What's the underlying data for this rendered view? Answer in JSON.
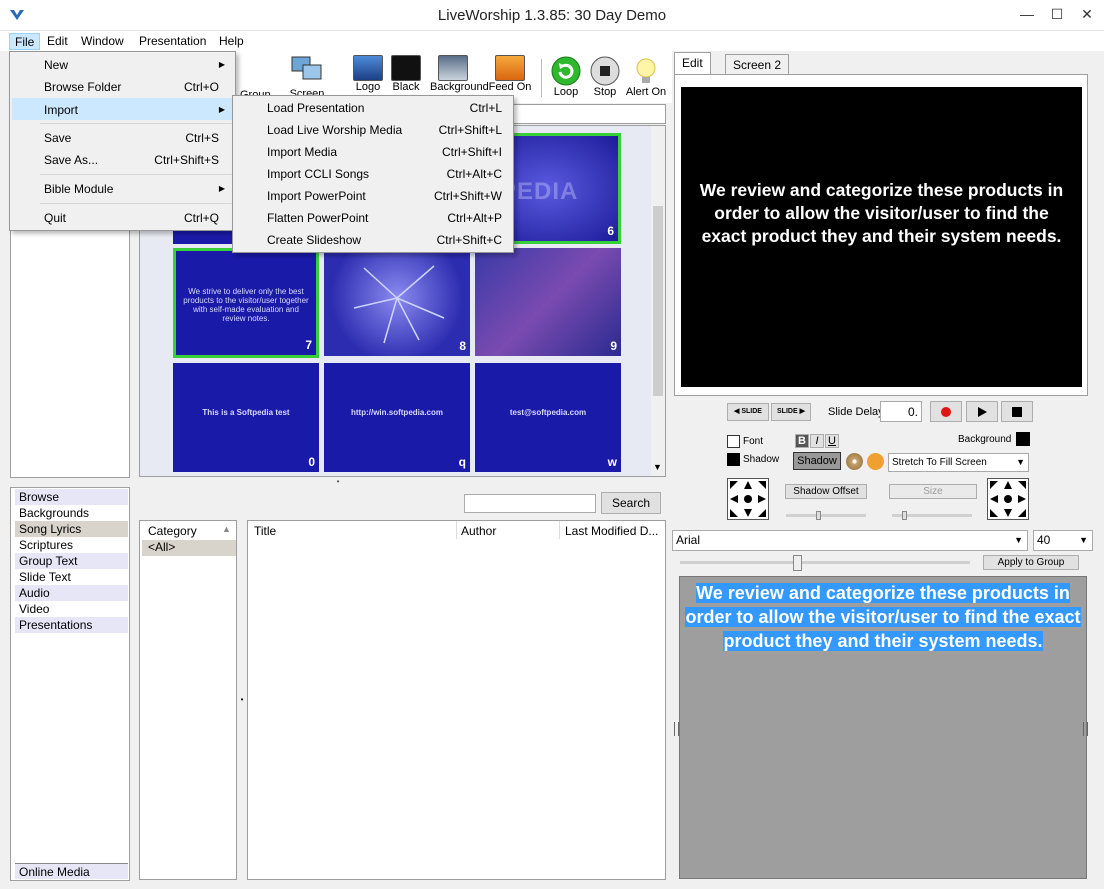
{
  "window": {
    "title": "LiveWorship 1.3.85: 30 Day Demo",
    "minimize": "—",
    "maximize": "☐",
    "close": "✕"
  },
  "menubar": [
    "File",
    "Edit",
    "Window",
    "Presentation",
    "Help"
  ],
  "toolbar": {
    "partial_labels": [
      "Group",
      "Screen 2 On"
    ],
    "buttons": [
      {
        "label": "Logo",
        "icon": "logo-icon"
      },
      {
        "label": "Black",
        "icon": "black-screen-icon"
      },
      {
        "label": "Background",
        "icon": "background-icon"
      },
      {
        "label": "Feed On",
        "icon": "feed-icon"
      },
      {
        "label": "Loop",
        "icon": "loop-icon"
      },
      {
        "label": "Stop",
        "icon": "stop-icon"
      },
      {
        "label": "Alert On",
        "icon": "bulb-icon"
      }
    ]
  },
  "file_menu": [
    {
      "label": "New",
      "shortcut": "",
      "submenu": true
    },
    {
      "label": "Browse Folder",
      "shortcut": "Ctrl+O",
      "submenu": false
    },
    {
      "label": "Import",
      "shortcut": "",
      "submenu": true
    },
    {
      "label": "Save",
      "shortcut": "Ctrl+S",
      "submenu": false
    },
    {
      "label": "Save As...",
      "shortcut": "Ctrl+Shift+S",
      "submenu": false
    },
    {
      "label": "Bible Module",
      "shortcut": "",
      "submenu": true
    },
    {
      "label": "Quit",
      "shortcut": "Ctrl+Q",
      "submenu": false
    }
  ],
  "import_menu": [
    {
      "label": "Load Presentation",
      "shortcut": "Ctrl+L"
    },
    {
      "label": "Load Live Worship Media",
      "shortcut": "Ctrl+Shift+L"
    },
    {
      "label": "Import Media",
      "shortcut": "Ctrl+Shift+I"
    },
    {
      "label": "Import CCLI Songs",
      "shortcut": "Ctrl+Alt+C"
    },
    {
      "label": "Import PowerPoint",
      "shortcut": "Ctrl+Shift+W"
    },
    {
      "label": "Flatten PowerPoint",
      "shortcut": "Ctrl+Alt+P"
    },
    {
      "label": "Create Slideshow",
      "shortcut": "Ctrl+Shift+C"
    }
  ],
  "slides": [
    {
      "num": "6",
      "text": "",
      "style": "forest"
    },
    {
      "num": "7",
      "text": "We strive to deliver only the best products to the visitor/user together with self-made evaluation and review notes.",
      "style": "plain"
    },
    {
      "num": "8",
      "text": "",
      "style": "thorns"
    },
    {
      "num": "9",
      "text": "",
      "style": "leaves"
    },
    {
      "num": "0",
      "text": "This is a Softpedia test",
      "style": "plain"
    },
    {
      "num": "q",
      "text": "http://win.softpedia.com",
      "style": "plain"
    },
    {
      "num": "w",
      "text": "test@softpedia.com",
      "style": "plain"
    }
  ],
  "library": {
    "items": [
      "Browse",
      "Backgrounds",
      "Song Lyrics",
      "Scriptures",
      "Group Text",
      "Slide Text",
      "Audio",
      "Video",
      "Presentations"
    ],
    "footer": "Online Media"
  },
  "search": {
    "value": "",
    "button": "Search"
  },
  "table": {
    "category_header": "Category",
    "category_value": "<All>",
    "columns": [
      "Title",
      "Author",
      "Last Modified D..."
    ]
  },
  "edit_tabs": [
    "Edit",
    "Screen 2"
  ],
  "preview_text": "We review and categorize these products in order to allow the visitor/user to find the exact product they and their system needs.",
  "playback": {
    "prev": "◀ SLIDE",
    "next": "SLIDE ▶",
    "delay_label": "Slide Delay",
    "delay_value": "0."
  },
  "format": {
    "font_label": "Font",
    "shadow_label": "Shadow",
    "bold": "B",
    "italic": "I",
    "underline": "U",
    "shadow_button": "Shadow",
    "background_label": "Background",
    "fill_mode": "Stretch To Fill Screen",
    "shadow_offset": "Shadow Offset",
    "size": "Size",
    "font_family": "Arial",
    "font_size": "40",
    "apply_group": "Apply to Group"
  },
  "watermark": "SOFTPEDIA"
}
